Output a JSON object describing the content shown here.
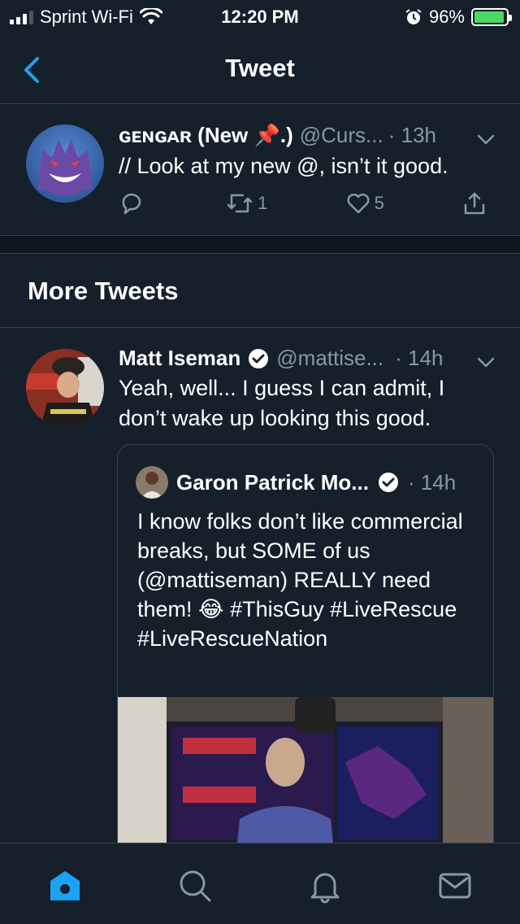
{
  "status_bar": {
    "carrier": "Sprint Wi-Fi",
    "time": "12:20 PM",
    "battery": "96%",
    "battery_level": 0.96
  },
  "nav": {
    "title": "Tweet",
    "back_icon": "chevron-left-icon"
  },
  "main_tweet": {
    "name": "ɢᴇɴɢᴀʀ (New 📌.)",
    "handle": "@Curs...",
    "time": "· 13h",
    "text": "// Look at my new @, isn’t it good.",
    "reply_count": "",
    "retweet_count": "1",
    "like_count": "5"
  },
  "more_tweets": {
    "title": "More Tweets"
  },
  "second_tweet": {
    "name": "Matt Iseman",
    "handle": "@mattise...",
    "time": "· 14h",
    "text": "Yeah, well... I guess I can admit, I don’t wake up looking this good.",
    "quote": {
      "name": "Garon Patrick Mo...",
      "time": "· 14h",
      "text": "I know folks don’t like commercial breaks, but SOME of us (@mattiseman) REALLY need them! 😂 #ThisGuy #LiveRescue #LiveRescueNation"
    }
  },
  "colors": {
    "background": "#15202b",
    "accent": "#1da1f2",
    "muted": "#8899a6",
    "divider": "#38444d"
  },
  "tab_bar": {
    "items": [
      "home-icon",
      "search-icon",
      "notifications-icon",
      "messages-icon"
    ],
    "active": "home-icon"
  }
}
